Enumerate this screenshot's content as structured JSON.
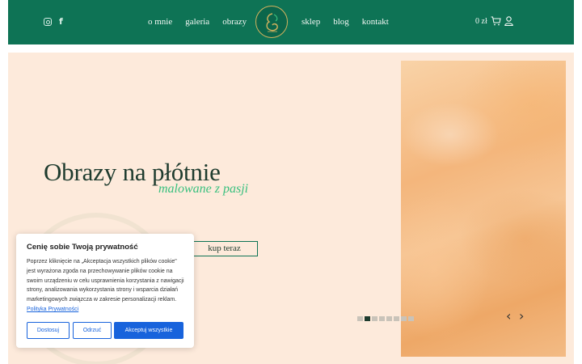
{
  "header": {
    "icons": {
      "instagram": "instagram-icon",
      "facebook": "facebook-icon",
      "cart": "cart-icon",
      "user": "user-icon"
    },
    "facebook_glyph": "f",
    "nav_left": [
      "o mnie",
      "galeria",
      "obrazy"
    ],
    "nav_right": [
      "sklep",
      "blog",
      "kontakt"
    ],
    "cart_amount": "0 zł",
    "colors": {
      "bar": "#0e7355",
      "logo_ring": "#d4b35e"
    }
  },
  "hero": {
    "title": "Obrazy na płótnie",
    "subtitle": "malowane z pasji",
    "cta_label": "kup teraz",
    "arrow_prev": "‹",
    "arrow_next": "›",
    "slides_count": 8,
    "active_slide": 2,
    "colors": {
      "background": "#fdeadb",
      "subtitle": "#3ac07f",
      "title": "#1e3b2e"
    }
  },
  "cookie": {
    "title": "Cenię sobie Twoją prywatność",
    "text": "Poprzez kliknięcie na „Akceptacja wszystkich plików cookie\" jest wyrażona zgoda na przechowywanie plików cookie na swoim urządzeniu w celu usprawnienia korzystania z nawigacji strony, analizowania wykorzystania strony i wsparcia działań marketingowych związcza w zakresie personalizacji reklam.",
    "link": "Polityka Prywatności",
    "buttons": {
      "customize": "Dostosuj",
      "reject": "Odrzuć",
      "accept": "Akceptuj wszystkie"
    },
    "colors": {
      "accent": "#1863dc"
    }
  }
}
